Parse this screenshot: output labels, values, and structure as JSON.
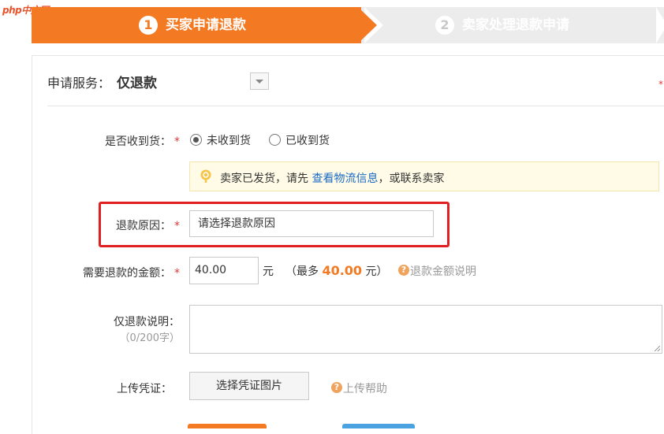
{
  "watermark": "php中文网",
  "steps": [
    {
      "number": "1",
      "label": "买家申请退款",
      "active": true
    },
    {
      "number": "2",
      "label": "卖家处理退款申请",
      "active": false
    }
  ],
  "colors": {
    "accent": "#f37a22",
    "highlight": "#e02020",
    "link": "#1a6bc6",
    "required": "#e4393c"
  },
  "service": {
    "label": "申请服务：",
    "value": "仅退款"
  },
  "received": {
    "label": "是否收到货：",
    "required": "*",
    "options": [
      {
        "label": "未收到货",
        "checked": true
      },
      {
        "label": "已收到货",
        "checked": false
      }
    ]
  },
  "notice": {
    "icon": "lightbulb-icon",
    "text_before": "卖家已发货，请先",
    "link": "查看物流信息",
    "text_after": "，或联系卖家"
  },
  "reason": {
    "label": "退款原因：",
    "required": "*",
    "placeholder": "请选择退款原因"
  },
  "amount": {
    "label": "需要退款的金额：",
    "required": "*",
    "value": "40.00",
    "unit": "元",
    "max_prefix": "（最多",
    "max_value": "40.00",
    "max_suffix": "元）",
    "help": "退款金额说明"
  },
  "description": {
    "label": "仅退款说明：",
    "count": "（0/200字）",
    "value": ""
  },
  "upload": {
    "label": "上传凭证：",
    "button": "选择凭证图片",
    "help": "上传帮助"
  }
}
